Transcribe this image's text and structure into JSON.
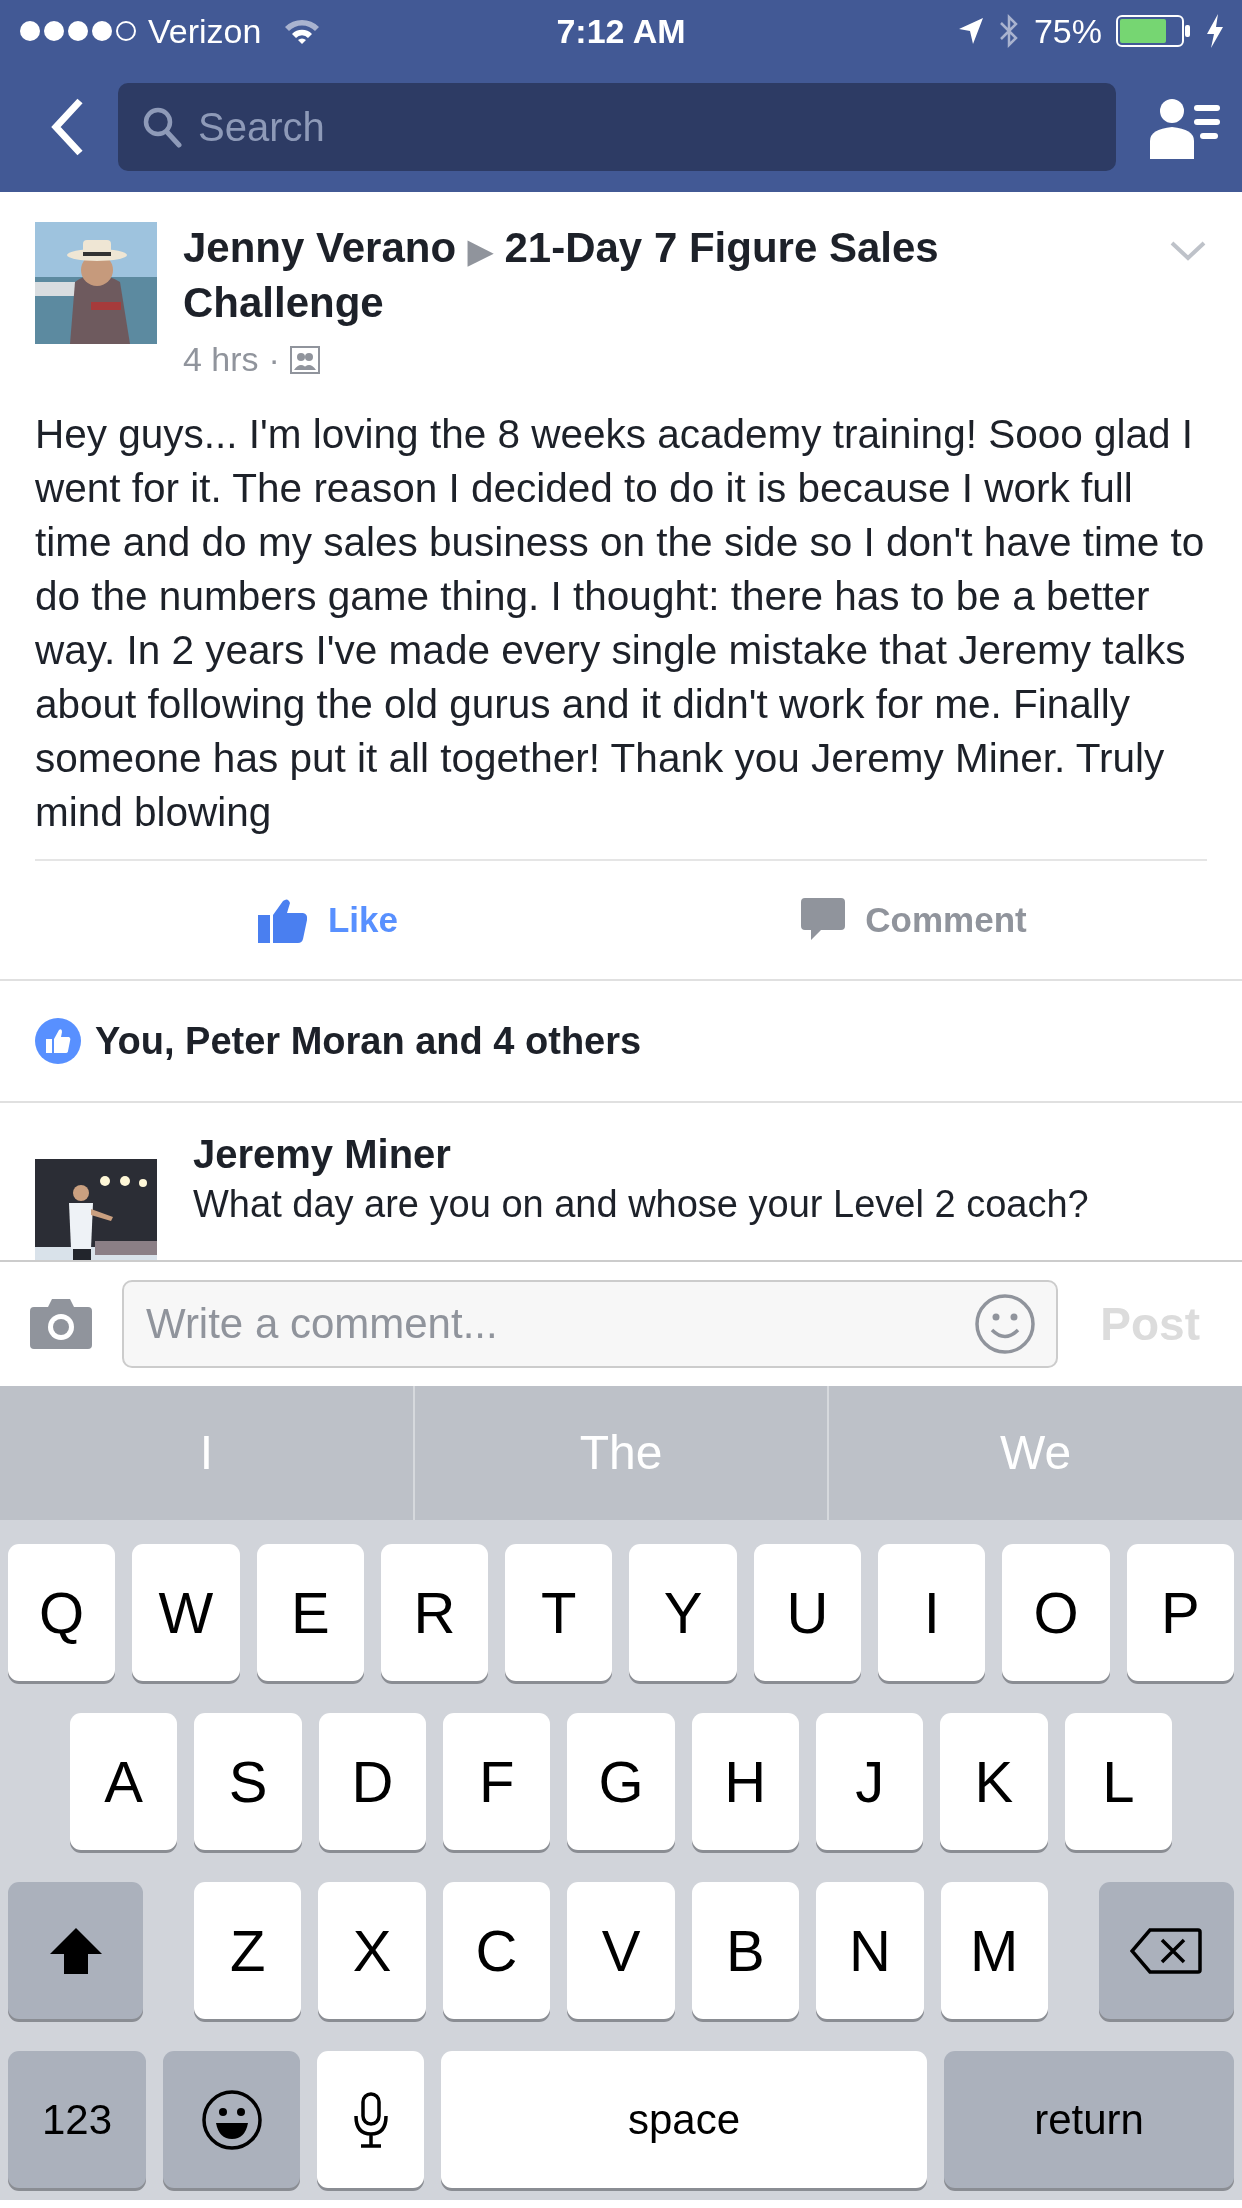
{
  "status_bar": {
    "carrier": "Verizon",
    "time": "7:12 AM",
    "battery": "75%"
  },
  "nav": {
    "search": {
      "placeholder": "Search"
    }
  },
  "post": {
    "author": "Jenny Verano",
    "arrow": "▶",
    "group": "21-Day 7 Figure Sales Challenge",
    "time": "4 hrs",
    "separator": "·",
    "body": "Hey guys... I'm loving the 8 weeks academy training! Sooo glad I went for it. The reason I decided to do it is because I work full time and do my sales business on the side so I don't have time to do the numbers game thing. I thought: there has to be a better way. In 2 years I've made every single mistake that Jeremy talks about following the old gurus and it didn't work for me. Finally someone has put it all together! Thank you Jeremy Miner. Truly mind blowing",
    "actions": [
      {
        "kind": "like",
        "label": "Like",
        "active": true
      },
      {
        "kind": "comment",
        "label": "Comment",
        "active": false
      }
    ],
    "likes": "You, Peter Moran and 4 others"
  },
  "comment": {
    "author": "Jeremy Miner",
    "text": "What day are you on and whose your Level 2 coach?"
  },
  "composer": {
    "placeholder": "Write a comment...",
    "post_button": {
      "label": "Post",
      "disabled": true
    }
  },
  "suggestions": [
    "I",
    "The",
    "We"
  ],
  "keyboard": {
    "rows": [
      {
        "keys": [
          {
            "kind": "letter",
            "label": "Q"
          },
          {
            "kind": "letter",
            "label": "W"
          },
          {
            "kind": "letter",
            "label": "E"
          },
          {
            "kind": "letter",
            "label": "R"
          },
          {
            "kind": "letter",
            "label": "T"
          },
          {
            "kind": "letter",
            "label": "Y"
          },
          {
            "kind": "letter",
            "label": "U"
          },
          {
            "kind": "letter",
            "label": "I"
          },
          {
            "kind": "letter",
            "label": "O"
          },
          {
            "kind": "letter",
            "label": "P"
          }
        ]
      },
      {
        "keys": [
          {
            "kind": "letter",
            "label": "A"
          },
          {
            "kind": "letter",
            "label": "S"
          },
          {
            "kind": "letter",
            "label": "D"
          },
          {
            "kind": "letter",
            "label": "F"
          },
          {
            "kind": "letter",
            "label": "G"
          },
          {
            "kind": "letter",
            "label": "H"
          },
          {
            "kind": "letter",
            "label": "J"
          },
          {
            "kind": "letter",
            "label": "K"
          },
          {
            "kind": "letter",
            "label": "L"
          }
        ]
      },
      {
        "keys": [
          {
            "kind": "shift"
          },
          {
            "kind": "letter",
            "label": "Z"
          },
          {
            "kind": "letter",
            "label": "X"
          },
          {
            "kind": "letter",
            "label": "C"
          },
          {
            "kind": "letter",
            "label": "V"
          },
          {
            "kind": "letter",
            "label": "B"
          },
          {
            "kind": "letter",
            "label": "N"
          },
          {
            "kind": "letter",
            "label": "M"
          },
          {
            "kind": "backspace"
          }
        ]
      },
      {
        "keys": [
          {
            "kind": "numbers",
            "label": "123"
          },
          {
            "kind": "emoji"
          },
          {
            "kind": "mic"
          },
          {
            "kind": "space",
            "label": "space"
          },
          {
            "kind": "return",
            "label": "return"
          }
        ]
      }
    ]
  }
}
